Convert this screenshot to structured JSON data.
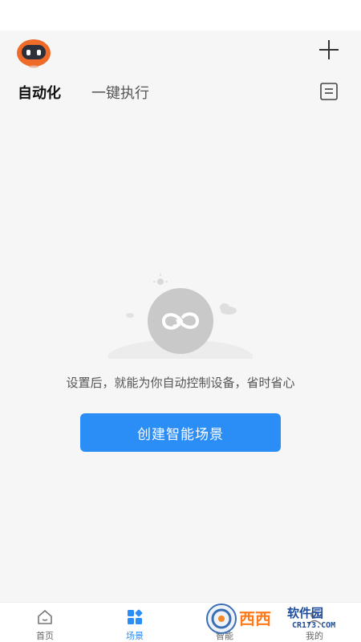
{
  "header": {
    "avatar_icon": "robot-avatar-icon",
    "add_icon": "plus-icon"
  },
  "tabs": {
    "active": "自动化",
    "inactive": "一键执行",
    "list_icon": "list-icon"
  },
  "empty_state": {
    "illustration_icon": "cycle-icon",
    "message": "设置后，就能为你自动控制设备，省时省心",
    "button_label": "创建智能场景"
  },
  "bottom_nav": [
    {
      "label": "首页",
      "icon": "home-icon",
      "active": false
    },
    {
      "label": "场景",
      "icon": "scene-grid-icon",
      "active": true
    },
    {
      "label": "智能",
      "icon": "smart-icon",
      "active": false
    },
    {
      "label": "我的",
      "icon": "profile-icon",
      "active": false
    }
  ],
  "watermark": {
    "brand": "西西",
    "site_name": "软件园",
    "domain": "CR173.COM"
  },
  "colors": {
    "accent": "#2b8ef6",
    "avatar_orange": "#ee6b2a",
    "background": "#f6f6f6"
  }
}
